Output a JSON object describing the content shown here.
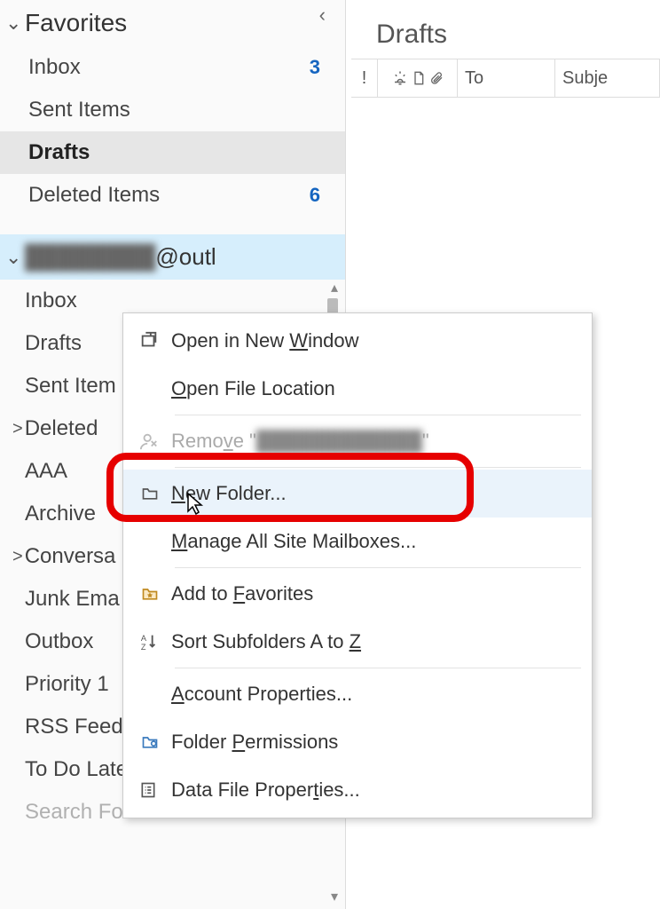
{
  "nav": {
    "favorites_label": "Favorites",
    "favorites": [
      {
        "label": "Inbox",
        "count": "3"
      },
      {
        "label": "Sent Items",
        "count": ""
      },
      {
        "label": "Drafts",
        "count": ""
      },
      {
        "label": "Deleted Items",
        "count": "6"
      }
    ],
    "account_obscured": "████████",
    "account_suffix": "@outl",
    "folders": [
      {
        "label": "Inbox",
        "expand": ""
      },
      {
        "label": "Drafts",
        "expand": ""
      },
      {
        "label": "Sent Item",
        "expand": ""
      },
      {
        "label": "Deleted",
        "expand": ">"
      },
      {
        "label": "AAA",
        "expand": ""
      },
      {
        "label": "Archive",
        "expand": ""
      },
      {
        "label": "Conversa",
        "expand": ">"
      },
      {
        "label": "Junk Ema",
        "expand": ""
      },
      {
        "label": "Outbox",
        "expand": ""
      },
      {
        "label": "Priority 1",
        "expand": ""
      },
      {
        "label": "RSS Feeds",
        "expand": ""
      },
      {
        "label": "To Do Later",
        "expand": ""
      },
      {
        "label": "Search Folders",
        "expand": ""
      }
    ]
  },
  "reading": {
    "title": "Drafts",
    "columns": {
      "priority": "!",
      "to": "To",
      "subject": "Subje"
    }
  },
  "menu": {
    "open_new_window_pre": "Open in New ",
    "open_new_window_u": "W",
    "open_new_window_post": "indow",
    "open_file_location_u": "O",
    "open_file_location_post": "pen File Location",
    "remove_pre": "Remo",
    "remove_u": "v",
    "remove_post": "e \"",
    "remove_blur": "████████████",
    "remove_after": "\"",
    "new_folder_u": "N",
    "new_folder_post": "ew Folder...",
    "manage_u": "M",
    "manage_post": "anage All Site Mailboxes...",
    "add_fav_pre": "Add to ",
    "add_fav_u": "F",
    "add_fav_post": "avorites",
    "sort_pre": "Sort Subfolders A to ",
    "sort_u": "Z",
    "account_props_u": "A",
    "account_props_post": "ccount Properties...",
    "folder_perm_pre": "Folder ",
    "folder_perm_u": "P",
    "folder_perm_post": "ermissions",
    "data_file_pre": "Data File Proper",
    "data_file_u": "t",
    "data_file_post": "ies..."
  }
}
